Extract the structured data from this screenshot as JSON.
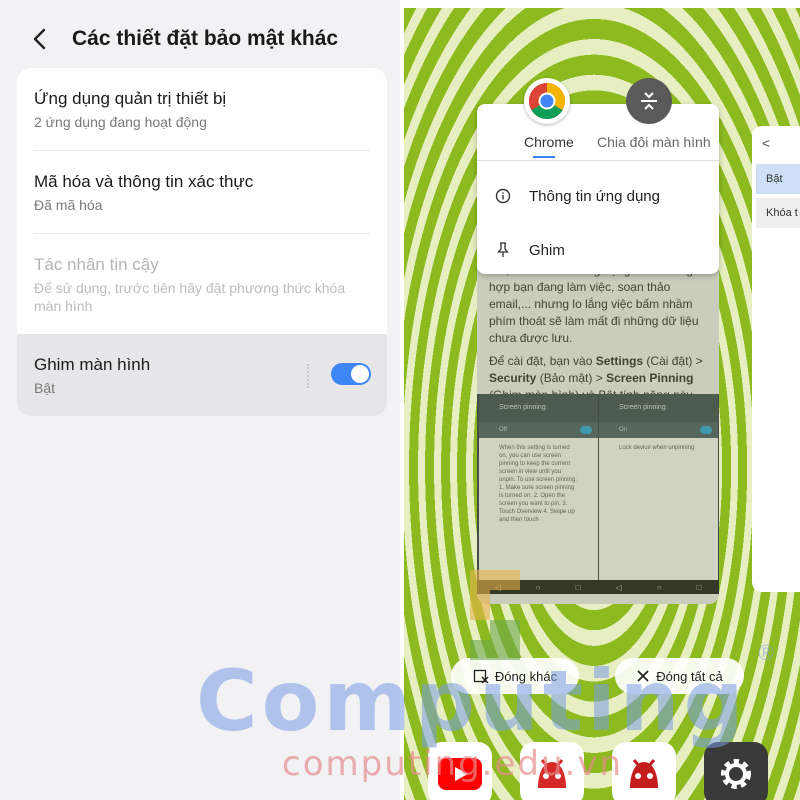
{
  "left": {
    "title": "Các thiết đặt bảo mật khác",
    "items": [
      {
        "title": "Ứng dụng quản trị thiết bị",
        "subtitle": "2 ứng dụng đang hoạt động"
      },
      {
        "title": "Mã hóa và thông tin xác thực",
        "subtitle": "Đã mã hóa"
      },
      {
        "title": "Tác nhân tin cậy",
        "subtitle": "Để sử dụng, trước tiên hãy đặt phương thức khóa màn hình"
      },
      {
        "title": "Ghim màn hình",
        "subtitle": "Bật",
        "toggle": true
      }
    ]
  },
  "right": {
    "popup": {
      "tab_chrome": "Chrome",
      "tab_split": "Chia đôi màn hình",
      "menu": [
        "Thông tin ứng dụng",
        "Ghim"
      ]
    },
    "article": {
      "p1": "Hoặc còn có thể ứng dụng vào trường hợp bạn đang làm việc, soạn thảo email,... nhưng lo lắng việc bấm nhầm phím thoát sẽ làm mất đi những dữ liệu chưa được lưu.",
      "p2_a": "Để cài đặt, bạn vào ",
      "p2_b": "Settings",
      "p2_c": " (Cài đặt) > ",
      "p2_d": "Security",
      "p2_e": " (Bảo mật) > ",
      "p2_f": "Screen Pinning",
      "p2_g": " (Ghim màn hình) và Bật tính năng này lên.",
      "screen1_title": "Screen pinning",
      "screen1_state": "Off",
      "screen1_body": "When this setting is turned on, you can use screen pinning to keep the current screen in view until you unpin. To use screen pinning: 1. Make sure screen pinning is turned on. 2. Open the screen you want to pin. 3. Touch Overview 4. Swipe up and then touch",
      "screen2_title": "Screen pinning",
      "screen2_state": "On",
      "screen2_body": "Lock device when unpinning"
    },
    "peek": {
      "header": "<",
      "row1": "Bật",
      "row2": "Khóa t"
    },
    "btn_close_others": "Đóng khác",
    "btn_close_all": "Đóng tất cả"
  },
  "watermark": {
    "big": "Computing",
    "reg": "®",
    "small": "computing.edu.vn"
  },
  "colors": {
    "accent": "#3e86f5",
    "pattern_green": "#8dbb1f"
  }
}
